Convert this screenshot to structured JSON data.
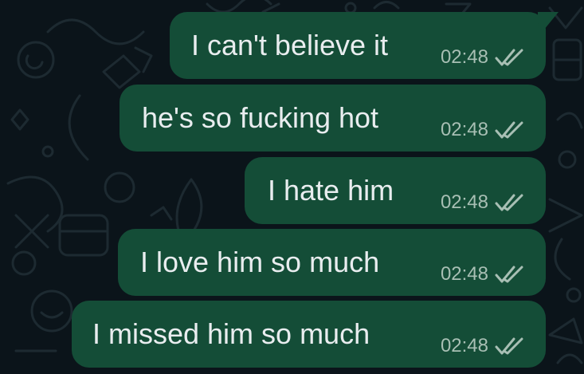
{
  "chat": {
    "messages": [
      {
        "text": "I can't believe it",
        "time": "02:48",
        "status": "read",
        "status_icon": "double-check-icon"
      },
      {
        "text": "he's so fucking hot",
        "time": "02:48",
        "status": "read",
        "status_icon": "double-check-icon"
      },
      {
        "text": "I hate him",
        "time": "02:48",
        "status": "read",
        "status_icon": "double-check-icon"
      },
      {
        "text": "I love him so much",
        "time": "02:48",
        "status": "read",
        "status_icon": "double-check-icon"
      },
      {
        "text": "I missed him so much",
        "time": "02:48",
        "status": "read",
        "status_icon": "double-check-icon"
      }
    ]
  },
  "colors": {
    "background": "#0b141a",
    "outgoing_bubble": "#144d37",
    "message_text": "#e9edef",
    "timestamp": "#a8bfb4",
    "ticks": "#a8bfb4"
  }
}
